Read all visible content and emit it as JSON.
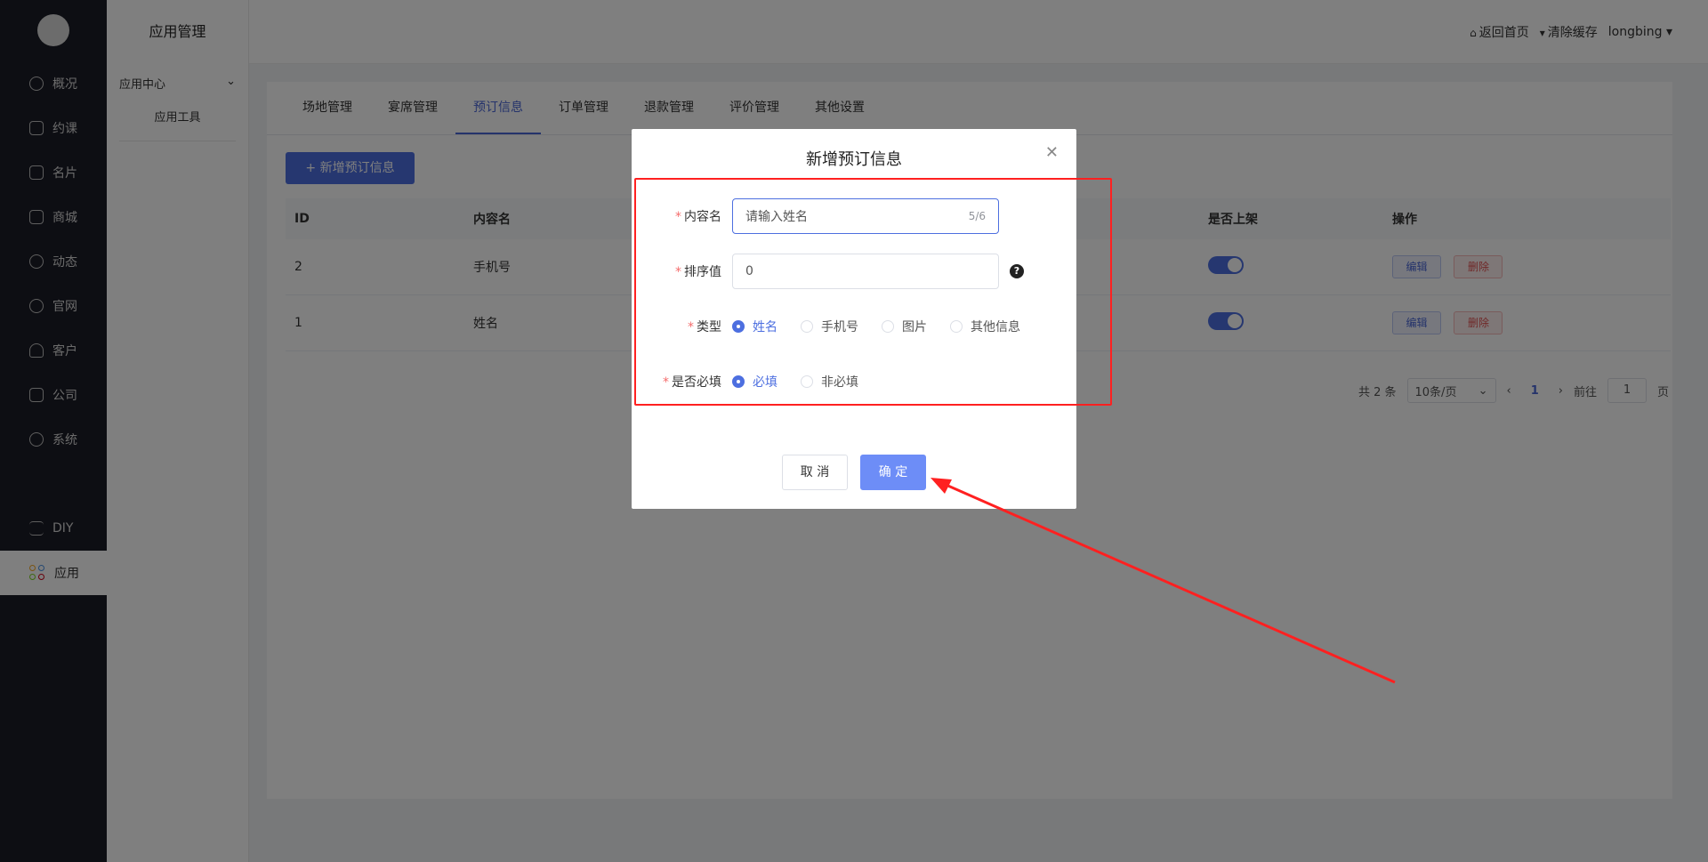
{
  "sidebar": {
    "items": [
      {
        "label": "概况",
        "icon": "pie-chart-icon"
      },
      {
        "label": "约课",
        "icon": "calendar-icon"
      },
      {
        "label": "名片",
        "icon": "card-icon"
      },
      {
        "label": "商城",
        "icon": "bag-icon"
      },
      {
        "label": "动态",
        "icon": "compass-icon"
      },
      {
        "label": "官网",
        "icon": "globe-icon"
      },
      {
        "label": "客户",
        "icon": "user-icon"
      },
      {
        "label": "公司",
        "icon": "org-icon"
      },
      {
        "label": "系统",
        "icon": "settings-icon"
      },
      {
        "label": "DIY",
        "icon": "diy-icon"
      },
      {
        "label": "应用",
        "icon": "apps-icon"
      }
    ]
  },
  "subside": {
    "title": "应用管理",
    "group": "应用中心",
    "item": "应用工具"
  },
  "header": {
    "home": "返回首页",
    "clear_cache": "清除缓存",
    "user": "longbing"
  },
  "tabs": [
    "场地管理",
    "宴席管理",
    "预订信息",
    "订单管理",
    "退款管理",
    "评价管理",
    "其他设置"
  ],
  "active_tab": "预订信息",
  "add_button": "+ 新增预订信息",
  "table": {
    "headers": [
      "ID",
      "内容名",
      "是否上架",
      "操作"
    ],
    "rows": [
      {
        "id": "2",
        "name": "手机号",
        "edit": "编辑",
        "delete": "删除"
      },
      {
        "id": "1",
        "name": "姓名",
        "edit": "编辑",
        "delete": "删除"
      }
    ]
  },
  "pager": {
    "total": "共 2 条",
    "size": "10条/页",
    "page": "1",
    "goto": "前往",
    "goto_value": "1",
    "page_suffix": "页"
  },
  "dialog": {
    "title": "新增预订信息",
    "name_label": "内容名",
    "name_placeholder": "请输入姓名",
    "name_count": "5/6",
    "sort_label": "排序值",
    "sort_value": "0",
    "type_label": "类型",
    "type_options": [
      "姓名",
      "手机号",
      "图片",
      "其他信息"
    ],
    "required_label": "是否必填",
    "required_options": [
      "必填",
      "非必填"
    ],
    "cancel": "取 消",
    "ok": "确 定"
  },
  "colors": {
    "accent": "#4d6fe0",
    "annotation": "#ff2020"
  }
}
